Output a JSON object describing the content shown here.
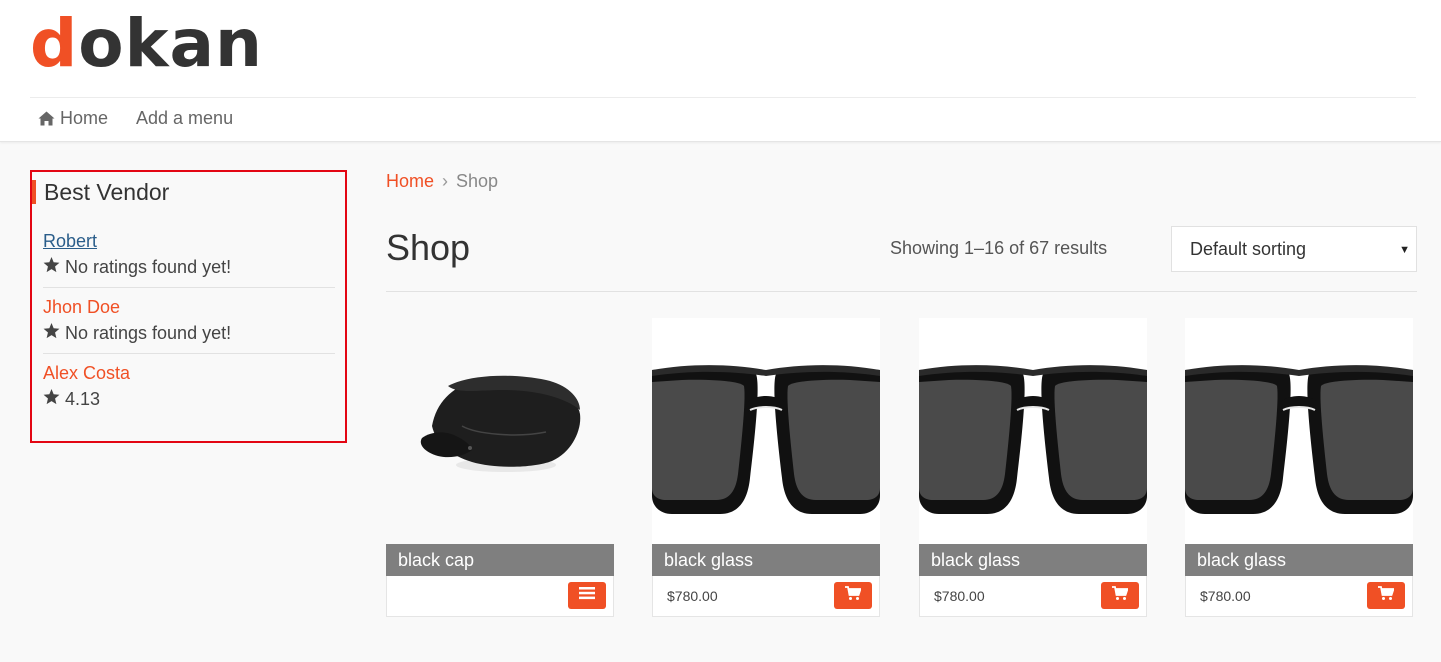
{
  "logo": {
    "first_letter": "d",
    "rest": "okan"
  },
  "nav": {
    "items": [
      {
        "label": "Home",
        "icon": "home-icon"
      },
      {
        "label": "Add a menu"
      }
    ]
  },
  "sidebar": {
    "widget_title": "Best Vendor",
    "vendors": [
      {
        "name": "Robert",
        "rating": "No ratings found yet!",
        "visited": true
      },
      {
        "name": "Jhon Doe",
        "rating": "No ratings found yet!",
        "visited": false
      },
      {
        "name": "Alex Costa",
        "rating": "4.13",
        "visited": false
      }
    ]
  },
  "breadcrumb": {
    "home": "Home",
    "separator": "›",
    "current": "Shop"
  },
  "page": {
    "title": "Shop",
    "result_count": "Showing 1–16 of 67 results",
    "sorting": {
      "selected": "Default sorting"
    }
  },
  "products": [
    {
      "name": "black cap",
      "price": "",
      "image": "cap",
      "button_icon": "menu-icon"
    },
    {
      "name": "black glass",
      "price": "$780.00",
      "image": "sunglasses",
      "button_icon": "cart-icon"
    },
    {
      "name": "black glass",
      "price": "$780.00",
      "image": "sunglasses",
      "button_icon": "cart-icon"
    },
    {
      "name": "black glass",
      "price": "$780.00",
      "image": "sunglasses",
      "button_icon": "cart-icon"
    }
  ],
  "colors": {
    "accent": "#f05025",
    "highlight_border": "#e30613",
    "visited_link": "#2a5d8a",
    "product_title_bg": "#7f7f7f"
  }
}
